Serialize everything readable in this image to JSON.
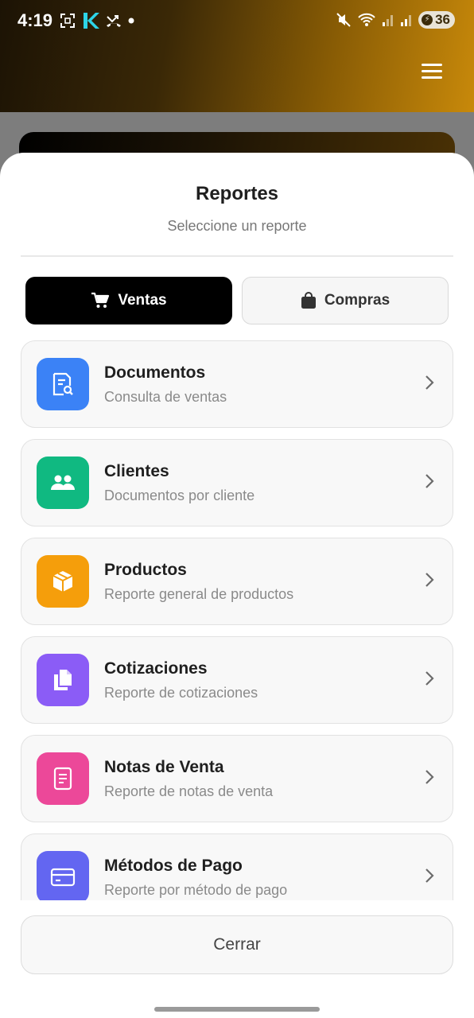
{
  "status_bar": {
    "time": "4:19",
    "battery": "36"
  },
  "sheet": {
    "title": "Reportes",
    "subtitle": "Seleccione un reporte"
  },
  "tabs": [
    {
      "label": "Ventas",
      "icon": "cart-icon",
      "active": true
    },
    {
      "label": "Compras",
      "icon": "bag-icon",
      "active": false
    }
  ],
  "reports": [
    {
      "title": "Documentos",
      "subtitle": "Consulta de ventas",
      "icon": "document-search-icon",
      "color": "#3b82f6"
    },
    {
      "title": "Clientes",
      "subtitle": "Documentos por cliente",
      "icon": "users-icon",
      "color": "#10b981"
    },
    {
      "title": "Productos",
      "subtitle": "Reporte general de productos",
      "icon": "box-icon",
      "color": "#f59e0b"
    },
    {
      "title": "Cotizaciones",
      "subtitle": "Reporte de cotizaciones",
      "icon": "copy-icon",
      "color": "#8b5cf6"
    },
    {
      "title": "Notas de Venta",
      "subtitle": "Reporte de notas de venta",
      "icon": "receipt-icon",
      "color": "#ec4899"
    },
    {
      "title": "Métodos de Pago",
      "subtitle": "Reporte por método de pago",
      "icon": "credit-card-icon",
      "color": "#6366f1"
    }
  ],
  "close_label": "Cerrar"
}
